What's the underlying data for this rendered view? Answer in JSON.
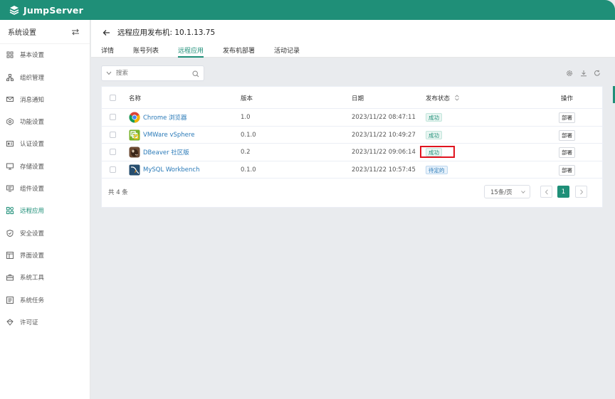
{
  "brand": {
    "name": "JumpServer",
    "color": "#1f8f78"
  },
  "sidebar": {
    "title": "系统设置",
    "toggle_icon": "swap-arrows-icon",
    "items": [
      {
        "label": "基本设置",
        "icon": "grid-icon"
      },
      {
        "label": "组织管理",
        "icon": "org-tree-icon"
      },
      {
        "label": "消息通知",
        "icon": "message-icon"
      },
      {
        "label": "功能设置",
        "icon": "feature-icon"
      },
      {
        "label": "认证设置",
        "icon": "id-card-icon"
      },
      {
        "label": "存储设置",
        "icon": "storage-icon"
      },
      {
        "label": "组件设置",
        "icon": "component-icon"
      },
      {
        "label": "远程应用",
        "icon": "apps-icon",
        "active": true
      },
      {
        "label": "安全设置",
        "icon": "shield-icon"
      },
      {
        "label": "界面设置",
        "icon": "layout-icon"
      },
      {
        "label": "系统工具",
        "icon": "toolbox-icon"
      },
      {
        "label": "系统任务",
        "icon": "task-list-icon"
      },
      {
        "label": "许可证",
        "icon": "license-icon"
      }
    ]
  },
  "header": {
    "title": "远程应用发布机: 10.1.13.75",
    "tabs": [
      {
        "label": "详情"
      },
      {
        "label": "账号列表"
      },
      {
        "label": "远程应用",
        "active": true
      },
      {
        "label": "发布机部署"
      },
      {
        "label": "活动记录"
      }
    ]
  },
  "toolbar": {
    "search_placeholder": "搜索",
    "icons": [
      "settings-icon",
      "download-icon",
      "refresh-icon"
    ]
  },
  "table": {
    "columns": {
      "name": "名称",
      "version": "版本",
      "date": "日期",
      "status": "发布状态",
      "actions": "操作"
    },
    "rows": [
      {
        "name": "Chrome 浏览器",
        "icon": "chrome-icon",
        "version": "1.0",
        "date": "2023/11/22 08:47:11",
        "status": "成功",
        "status_type": "success",
        "action": "部署"
      },
      {
        "name": "VMWare vSphere",
        "icon": "vsphere-icon",
        "version": "0.1.0",
        "date": "2023/11/22 10:49:27",
        "status": "成功",
        "status_type": "success",
        "action": "部署"
      },
      {
        "name": "DBeaver 社区版",
        "icon": "dbeaver-icon",
        "version": "0.2",
        "date": "2023/11/22 09:06:14",
        "status": "成功",
        "status_type": "success",
        "action": "部署",
        "highlighted": true
      },
      {
        "name": "MySQL Workbench",
        "icon": "mysql-workbench-icon",
        "version": "0.1.0",
        "date": "2023/11/22 10:57:45",
        "status": "待定的",
        "status_type": "pending",
        "action": "部署"
      }
    ]
  },
  "pagination": {
    "total_text": "共 4 条",
    "page_size": "15条/页",
    "current_page": "1"
  },
  "colors": {
    "accent": "#1f8f78",
    "highlight": "#e0141e",
    "link": "#2a7ab8"
  }
}
